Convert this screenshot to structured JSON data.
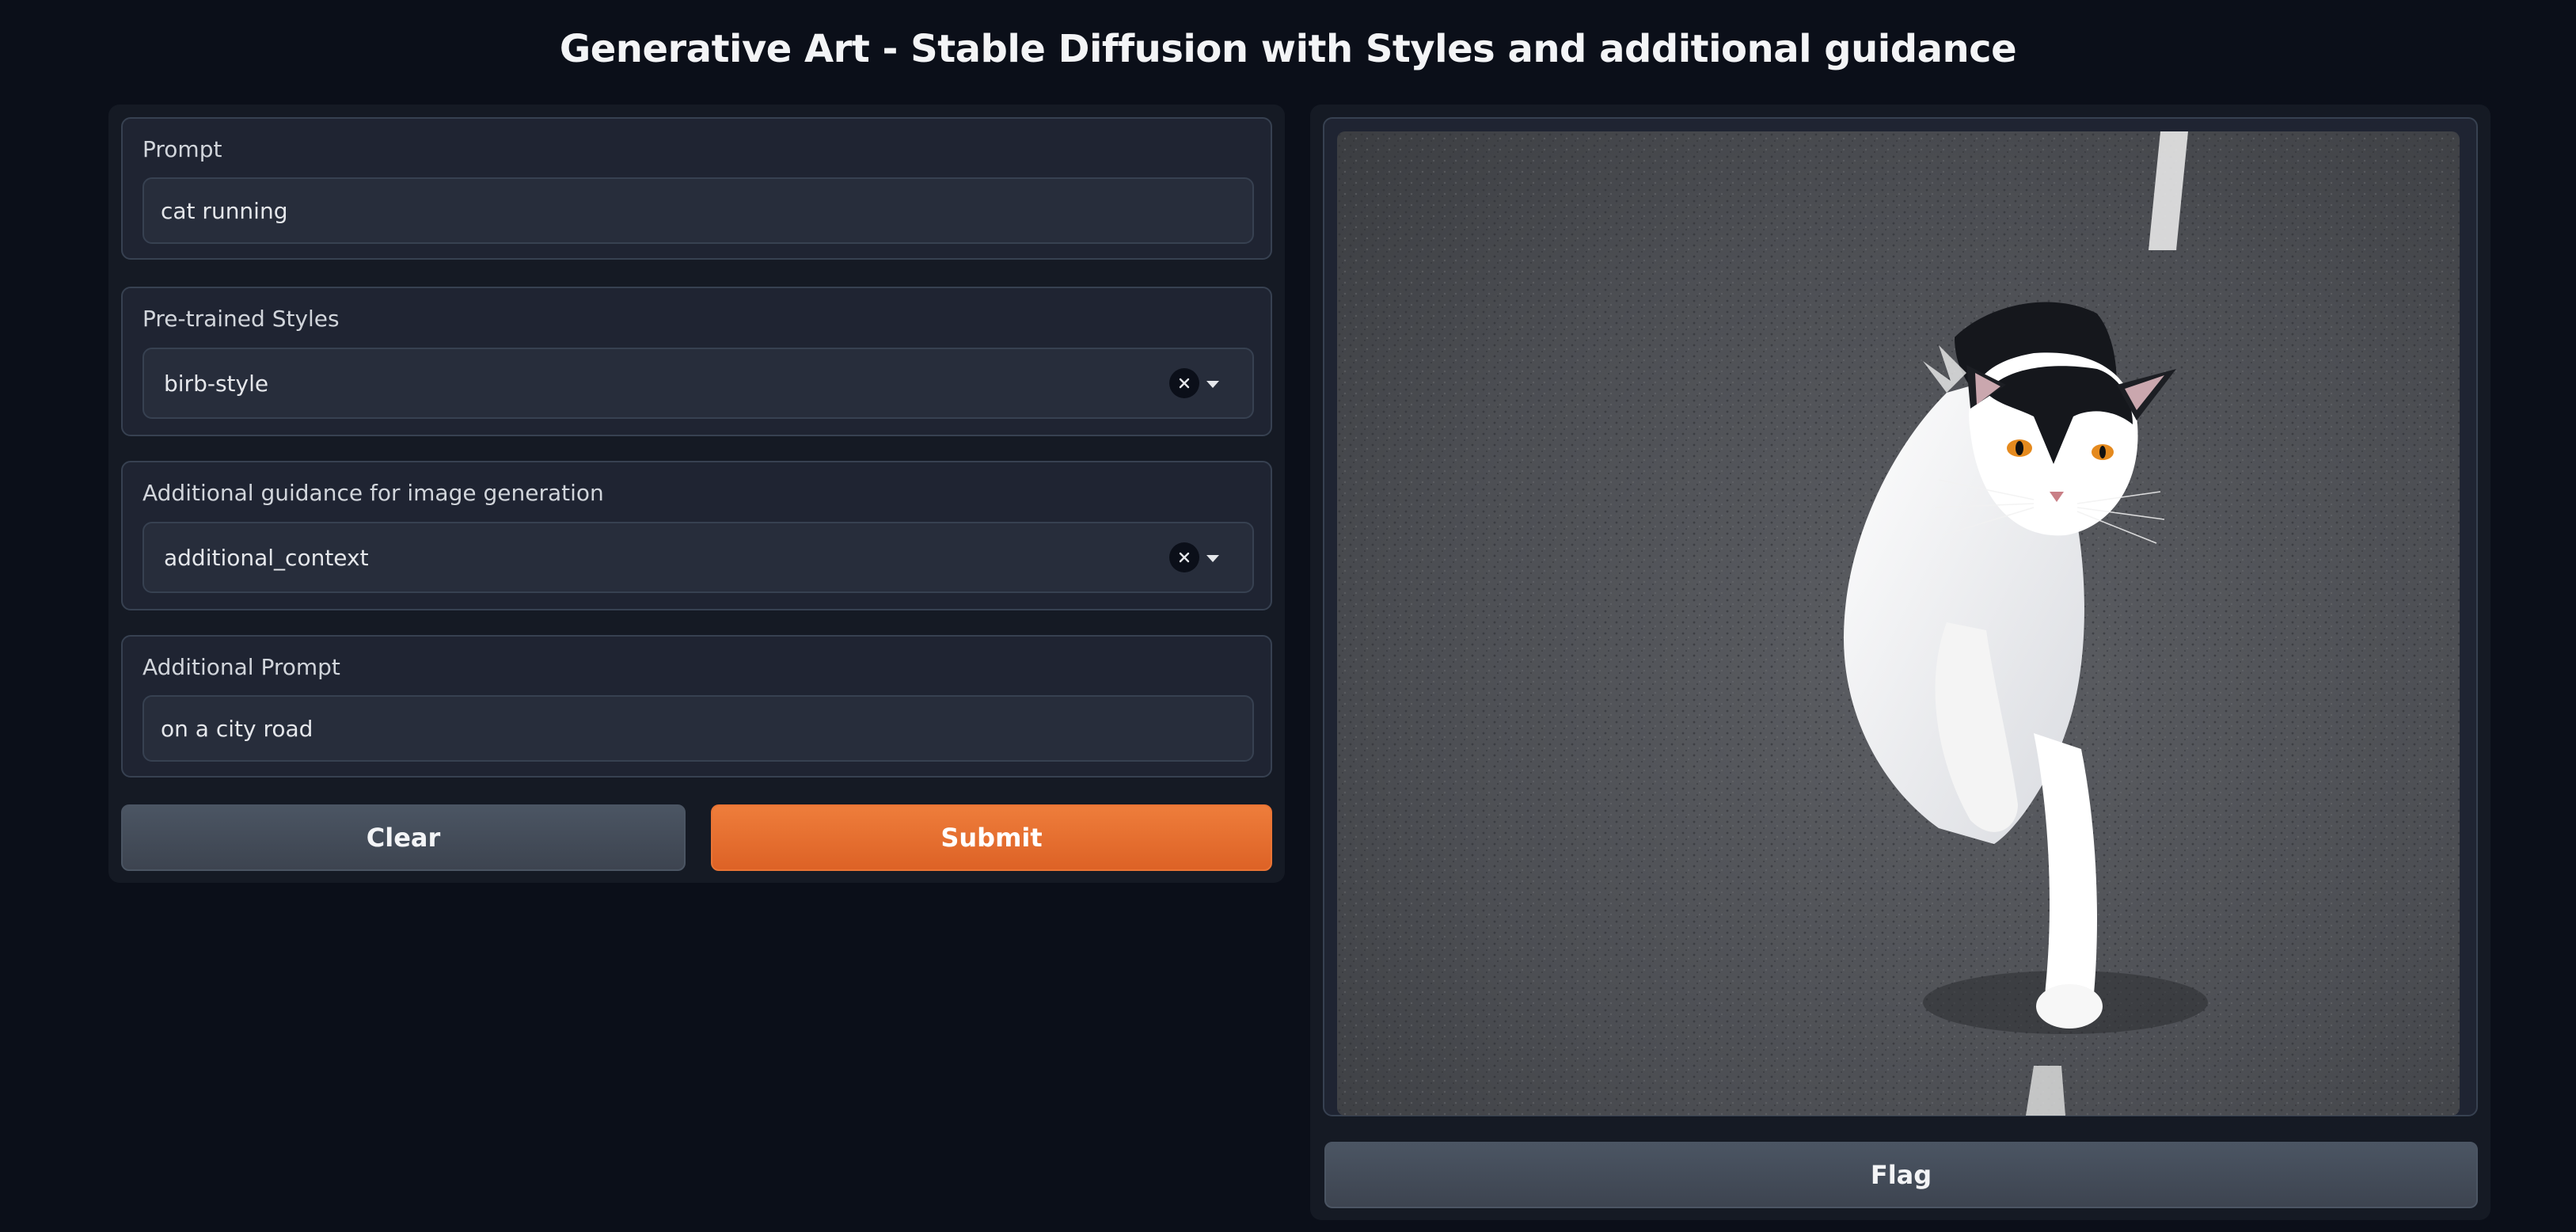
{
  "title": "Generative Art - Stable Diffusion with Styles and additional guidance",
  "prompt": {
    "label": "Prompt",
    "value": "cat running"
  },
  "styles": {
    "label": "Pre-trained Styles",
    "value": "birb-style"
  },
  "guidance": {
    "label": "Additional guidance for image generation",
    "value": "additional_context"
  },
  "additional_prompt": {
    "label": "Additional Prompt",
    "value": "on a city road"
  },
  "buttons": {
    "clear": "Clear",
    "submit": "Submit",
    "flag": "Flag"
  },
  "output_image": {
    "subject": "white and black cat running on an asphalt road"
  },
  "colors": {
    "accent": "#e8692c",
    "background": "#0b0f19",
    "panel": "#1f2432"
  }
}
